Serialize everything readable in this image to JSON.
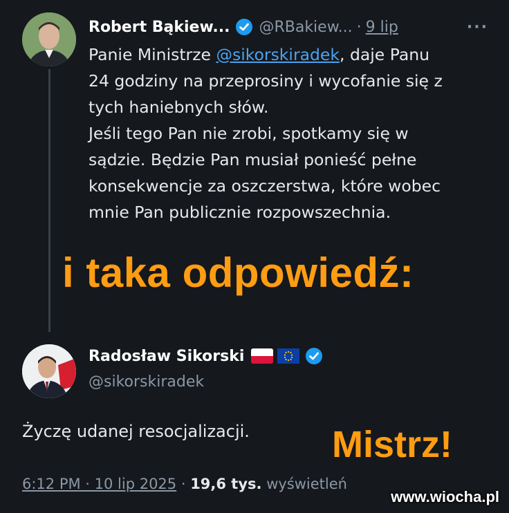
{
  "tweet1": {
    "name": "Robert Bąkiew...",
    "handle": "@RBakiew...",
    "separator": "·",
    "date": "9 lip",
    "more": "···",
    "body_prefix": "Panie Ministrze ",
    "mention": "@sikorskiradek",
    "body_rest": ", daje Panu\n24 godziny na przeprosiny i wycofanie się z\ntych haniebnych słów.\nJeśli tego Pan nie zrobi, spotkamy się w\nsądzie. Będzie Pan musiał ponieść pełne\nkonsekwencje za oszczerstwa, które wobec\nmnie Pan publicznie rozpowszechnia."
  },
  "caption": "i taka odpowiedź:",
  "tweet2": {
    "name": "Radosław Sikorski",
    "handle": "@sikorskiradek",
    "body": "Życzę udanej resocjalizacji.",
    "time": "6:12 PM · 10 lip 2025",
    "meta_sep": " · ",
    "views_count": "19,6 tys.",
    "views_label": " wyświetleń"
  },
  "overlay": {
    "mistrz": "Mistrz!",
    "watermark": "www.wiocha.pl"
  },
  "colors": {
    "background": "#15181d",
    "accent_orange": "#ff9d12",
    "link_blue": "#4aa3ef",
    "verified_blue": "#1d9bf0",
    "muted": "#8b98a5"
  },
  "icons": [
    "verified-badge-icon",
    "more-icon",
    "poland-flag-icon",
    "eu-flag-icon"
  ]
}
